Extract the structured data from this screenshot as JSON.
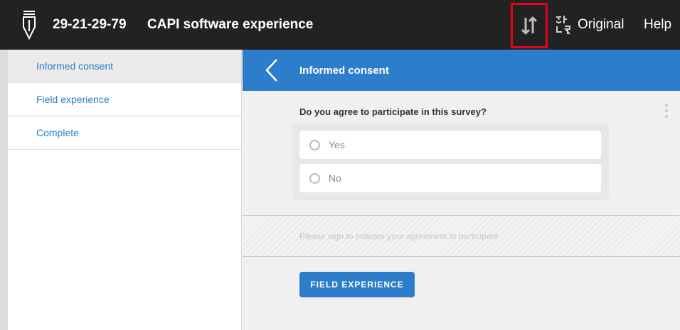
{
  "header": {
    "interview_id": "29-21-29-79",
    "survey_title": "CAPI software experience",
    "language_label": "Original",
    "help_label": "Help",
    "icons": {
      "logo": "pen-nib-logo-icon",
      "sort": "sort-arrows-icon",
      "language": "translate-icon"
    }
  },
  "sidebar": {
    "items": [
      {
        "label": "Informed consent",
        "active": true
      },
      {
        "label": "Field experience",
        "active": false
      },
      {
        "label": "Complete",
        "active": false
      }
    ]
  },
  "section": {
    "title": "Informed consent",
    "question": "Do you agree to participate in this survey?",
    "options": [
      "Yes",
      "No"
    ],
    "signature_hint": "Please sign to indicate your agreement to participate",
    "next_button_label": "FIELD EXPERIENCE"
  },
  "colors": {
    "topbar": "#222222",
    "accent": "#2c7ecb",
    "highlight_box": "#e8001c",
    "link": "#2a7ec7"
  }
}
